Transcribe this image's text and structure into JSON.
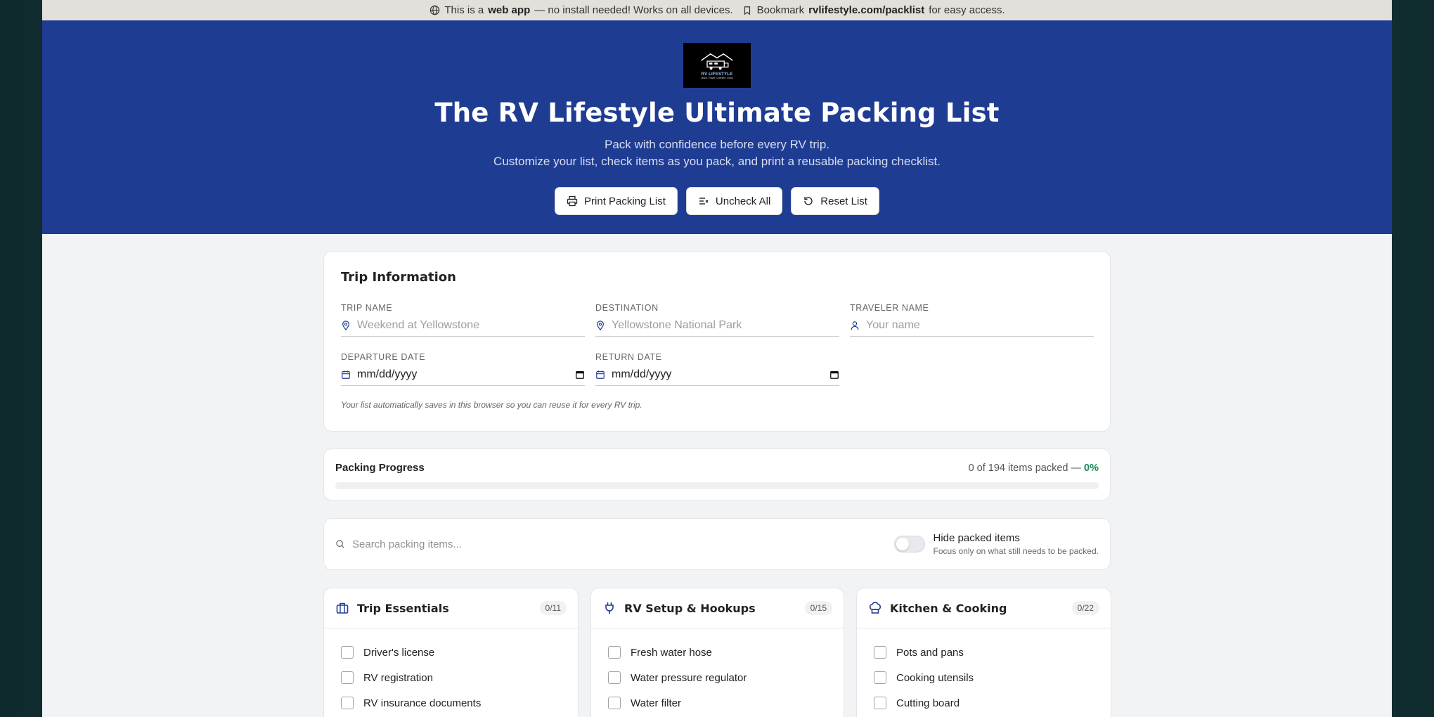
{
  "banner": {
    "prefix": "This is a",
    "bold1": "web app",
    "middle": "— no install needed! Works on all devices.",
    "bookmark_prefix": "Bookmark",
    "url": "rvlifestyle.com/packlist",
    "suffix": "for easy access."
  },
  "logo": {
    "title": "RV LIFESTYLE",
    "tagline": "Learn. Travel. Connect. Grow."
  },
  "hero": {
    "title": "The RV Lifestyle Ultimate Packing List",
    "line1": "Pack with confidence before every RV trip.",
    "line2": "Customize your list, check items as you pack, and print a reusable packing checklist.",
    "buttons": {
      "print": "Print Packing List",
      "uncheck": "Uncheck All",
      "reset": "Reset List"
    }
  },
  "trip": {
    "title": "Trip Information",
    "trip_name": {
      "label": "TRIP NAME",
      "placeholder": "Weekend at Yellowstone"
    },
    "destination": {
      "label": "DESTINATION",
      "placeholder": "Yellowstone National Park"
    },
    "traveler": {
      "label": "TRAVELER NAME",
      "placeholder": "Your name"
    },
    "departure": {
      "label": "DEPARTURE DATE",
      "value": "mm/dd/yyyy"
    },
    "return_date": {
      "label": "RETURN DATE",
      "value": "mm/dd/yyyy"
    },
    "note": "Your list automatically saves in this browser so you can reuse it for every RV trip."
  },
  "progress": {
    "title": "Packing Progress",
    "stat_text": "0 of 194 items packed —",
    "percent_text": "0%",
    "fraction": 0
  },
  "filter": {
    "search_placeholder": "Search packing items...",
    "toggle_label": "Hide packed items",
    "toggle_sub": "Focus only on what still needs to be packed.",
    "toggle_on": false
  },
  "categories": [
    {
      "title": "Trip Essentials",
      "count": "0/11",
      "items": [
        "Driver's license",
        "RV registration",
        "RV insurance documents"
      ]
    },
    {
      "title": "RV Setup & Hookups",
      "count": "0/15",
      "items": [
        "Fresh water hose",
        "Water pressure regulator",
        "Water filter"
      ]
    },
    {
      "title": "Kitchen & Cooking",
      "count": "0/22",
      "items": [
        "Pots and pans",
        "Cooking utensils",
        "Cutting board"
      ]
    }
  ],
  "colors": {
    "hero": "#1f3c93",
    "accent": "#1d8a5a"
  }
}
